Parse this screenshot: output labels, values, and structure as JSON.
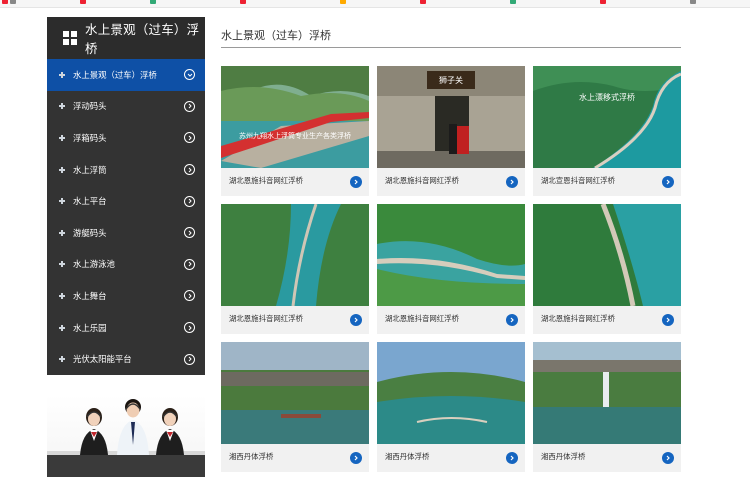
{
  "sidebar": {
    "title": "水上景观（过车）浮桥",
    "items": [
      {
        "label": "水上景观（过车）浮桥",
        "active": true
      },
      {
        "label": "浮动码头"
      },
      {
        "label": "浮箱码头"
      },
      {
        "label": "水上浮筒"
      },
      {
        "label": "水上平台"
      },
      {
        "label": "游艇码头"
      },
      {
        "label": "水上游泳池"
      },
      {
        "label": "水上舞台"
      },
      {
        "label": "水上乐园"
      },
      {
        "label": "光伏太阳能平台"
      }
    ]
  },
  "main": {
    "title": "水上景观（过车）浮桥",
    "cards": [
      {
        "caption": "湖北恩施抖音网红浮桥",
        "photo_text": "苏州九翔水上浮筒专业生产各类浮桥"
      },
      {
        "caption": "湖北恩施抖音网红浮桥",
        "photo_text": "狮子关"
      },
      {
        "caption": "湖北宣恩抖音网红浮桥",
        "photo_text": "水上漂移式浮桥"
      },
      {
        "caption": "湖北恩施抖音网红浮桥",
        "photo_text": ""
      },
      {
        "caption": "湖北恩施抖音网红浮桥",
        "photo_text": ""
      },
      {
        "caption": "湖北恩施抖音网红浮桥",
        "photo_text": ""
      },
      {
        "caption": "湘西丹体浮桥",
        "photo_text": ""
      },
      {
        "caption": "湘西丹体浮桥",
        "photo_text": ""
      },
      {
        "caption": "湘西丹体浮桥",
        "photo_text": ""
      }
    ]
  },
  "colors": {
    "sidebar_bg": "#333333",
    "active_item": "#0e50a6",
    "accent_button": "#1565c0"
  }
}
